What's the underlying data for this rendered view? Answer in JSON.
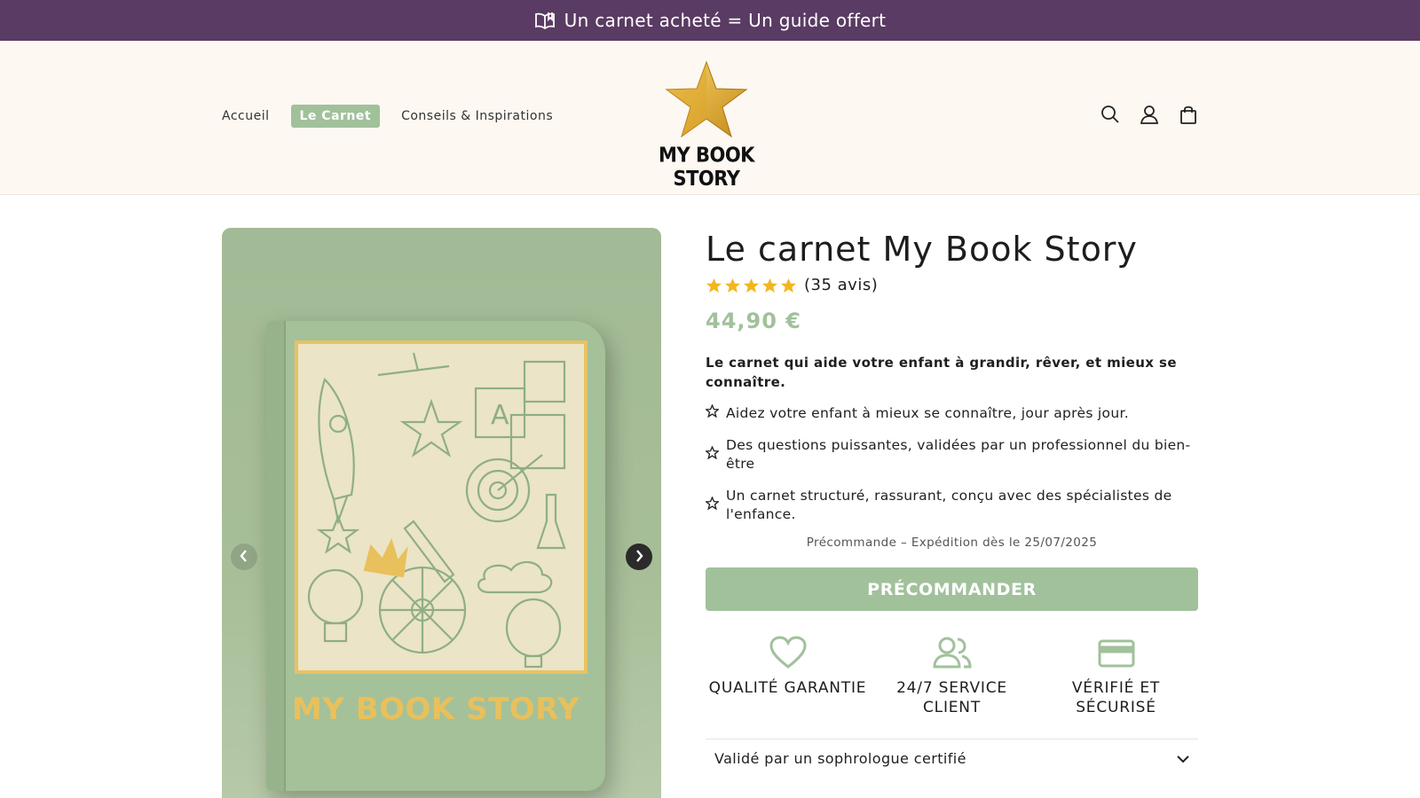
{
  "announcement": {
    "text": "Un carnet acheté = Un guide offert",
    "icon": "open-book-icon"
  },
  "nav": {
    "items": [
      {
        "label": "Accueil",
        "active": false
      },
      {
        "label": "Le Carnet",
        "active": true
      },
      {
        "label": "Conseils & Inspirations",
        "active": false
      }
    ]
  },
  "logo": {
    "text": "MY BOOK STORY",
    "icon": "gold-star-icon"
  },
  "header_icons": [
    "search-icon",
    "account-icon",
    "cart-icon"
  ],
  "product": {
    "cover_title": "MY BOOK STORY",
    "title": "Le carnet My Book Story",
    "rating_stars": 5,
    "reviews": "(35 avis)",
    "price": "44,90 €",
    "tagline": "Le carnet qui aide votre enfant à grandir, rêver, et mieux se connaître.",
    "bullets": [
      "Aidez votre enfant à mieux se connaître, jour après jour.",
      "Des questions puissantes, validées par un professionnel du bien-être",
      "Un carnet structuré, rassurant, conçu avec des spécialistes de l'enfance."
    ],
    "preorder_note": "Précommande – Expédition dès le 25/07/2025",
    "cta_label": "PRÉCOMMANDER",
    "features": [
      {
        "label": "QUALITÉ GARANTIE",
        "icon": "heart-icon"
      },
      {
        "label": "24/7 SERVICE CLIENT",
        "icon": "users-icon"
      },
      {
        "label": "VÉRIFIÉ ET SÉCURISÉ",
        "icon": "credit-card-icon"
      }
    ],
    "accordion_label": "Validé par un sophrologue certifié"
  },
  "colors": {
    "announce_bg": "#5a3b63",
    "accent": "#a1c19b",
    "header_bg": "#fdf8f2",
    "star": "#f2b61e"
  }
}
